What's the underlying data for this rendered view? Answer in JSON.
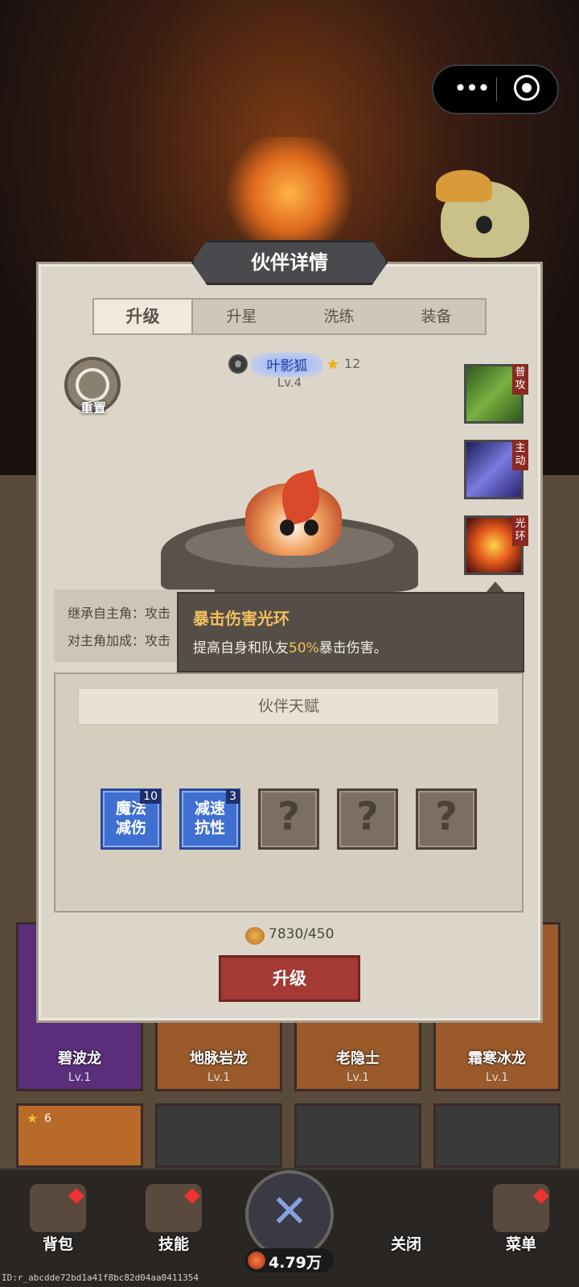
{
  "panel": {
    "title": "伙伴详情"
  },
  "tabs": [
    {
      "label": "升级",
      "active": true
    },
    {
      "label": "升星",
      "active": false
    },
    {
      "label": "洗练",
      "active": false
    },
    {
      "label": "装备",
      "active": false
    }
  ],
  "reset": {
    "label": "重置"
  },
  "partner": {
    "name": "叶影狐",
    "stars": "12",
    "level": "Lv.4"
  },
  "skills": [
    {
      "tag": "普攻",
      "icon": "leaf-skill-icon"
    },
    {
      "tag": "主动",
      "icon": "shadow-slash-skill-icon"
    },
    {
      "tag": "光环",
      "icon": "fire-aura-skill-icon"
    }
  ],
  "stats": {
    "line1": "继承自主角：攻击",
    "line2": "对主角加成：攻击"
  },
  "tooltip": {
    "title": "暴击伤害光环",
    "desc_before": "提高自身和队友",
    "desc_highlight": "50%",
    "desc_after": "暴击伤害。"
  },
  "talent": {
    "title": "伙伴天赋",
    "slots": [
      {
        "text": "魔法减伤",
        "badge": "10",
        "locked": false
      },
      {
        "text": "减速抗性",
        "badge": "3",
        "locked": false
      },
      {
        "text": "?",
        "locked": true
      },
      {
        "text": "?",
        "locked": true
      },
      {
        "text": "?",
        "locked": true
      }
    ]
  },
  "cost": {
    "value": "7830/450"
  },
  "upgrade_button": "升级",
  "cards": [
    {
      "name": "碧波龙",
      "level": "Lv.1"
    },
    {
      "name": "地脉岩龙",
      "level": "Lv.1"
    },
    {
      "name": "老隐士",
      "level": "Lv.1"
    },
    {
      "name": "霜寒冰龙",
      "level": "Lv.1"
    }
  ],
  "card_row2": {
    "star_count": "6"
  },
  "nav": {
    "bag": "背包",
    "skills": "技能",
    "currency": "4.79万",
    "close": "关闭",
    "menu": "菜单"
  },
  "footer_id": "ID:r_abcdde72bd1a41f8bc82d04aa0411354",
  "colors": {
    "panel_bg": "#dcd6ca",
    "upgrade_red": "#a33a34",
    "talent_blue": "#3f6fd0",
    "tooltip_gold": "#f3c060"
  }
}
